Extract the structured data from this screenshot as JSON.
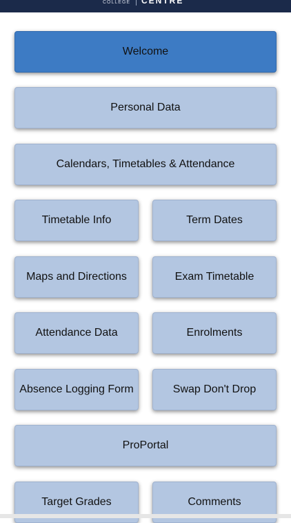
{
  "header": {
    "college_label": "COLLEGE",
    "centre_label": "CENTRE"
  },
  "menu": {
    "welcome": "Welcome",
    "personal_data": "Personal Data",
    "calendars": "Calendars, Timetables & Attendance",
    "timetable_info": "Timetable Info",
    "term_dates": "Term Dates",
    "maps": "Maps and Directions",
    "exam_timetable": "Exam Timetable",
    "attendance_data": "Attendance Data",
    "enrolments": "Enrolments",
    "absence_form": "Absence Logging Form",
    "swap_dont_drop": "Swap Don't Drop",
    "proportal": "ProPortal",
    "target_grades": "Target Grades",
    "comments": "Comments"
  },
  "colors": {
    "tile": "#b3c6e1",
    "tile_active": "#3d7bc4",
    "header": "#1b2a4a"
  }
}
